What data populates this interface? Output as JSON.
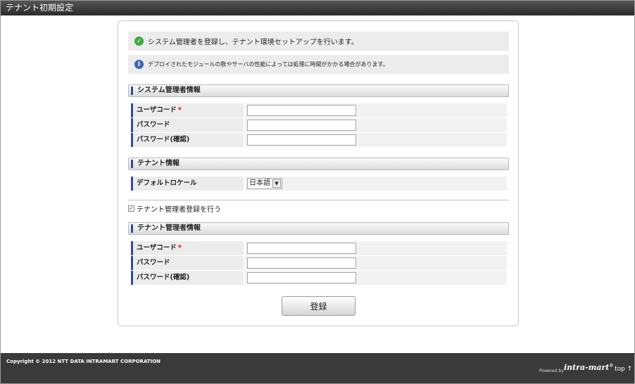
{
  "window": {
    "title": "テナント初期設定"
  },
  "messages": [
    {
      "icon": "check-icon",
      "text": "システム管理者を登録し、テナント環境セットアップを行います。"
    },
    {
      "icon": "info-icon",
      "text": "デプロイされたモジュールの数やサーバの性能によっては処理に時間がかかる場合があります。"
    }
  ],
  "system_admin": {
    "heading": "システム管理者情報",
    "fields": [
      {
        "label": "ユーザコード",
        "required": "*",
        "value": ""
      },
      {
        "label": "パスワード",
        "value": ""
      },
      {
        "label": "パスワード(確認)",
        "value": ""
      }
    ]
  },
  "tenant": {
    "heading": "テナント情報",
    "locale_label": "デフォルトロケール",
    "locale_value": "日本語"
  },
  "tenant_admin_toggle": {
    "label": "テナント管理者登録を行う",
    "checked": true
  },
  "tenant_admin": {
    "heading": "テナント管理者情報",
    "fields": [
      {
        "label": "ユーザコード",
        "required": "*",
        "value": ""
      },
      {
        "label": "パスワード",
        "value": ""
      },
      {
        "label": "パスワード(確認)",
        "value": ""
      }
    ]
  },
  "submit_label": "登録",
  "footer": {
    "copyright": "Copyright © 2012 NTT DATA INTRAMART CORPORATION",
    "powered_by": "Powered by",
    "logo": "intra-mart",
    "logo_mark": "®",
    "top_link": "top ↑"
  },
  "colors": {
    "accent": "#2e4f91",
    "header_bg": "#2a2a2a",
    "footer_bg": "#3a3a3a",
    "required": "#dd0000"
  }
}
